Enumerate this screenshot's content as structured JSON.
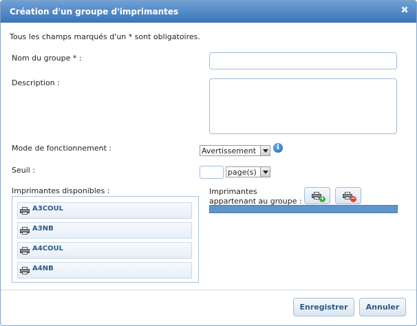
{
  "dialog": {
    "title": "Création d'un groupe d'imprimantes",
    "close_icon": "close-icon"
  },
  "form": {
    "required_note": "Tous les champs marqués d'un * sont obligatoires.",
    "group_name_label": "Nom du groupe * :",
    "group_name_value": "",
    "description_label": "Description :",
    "description_value": "",
    "mode_label": "Mode de fonctionnement :",
    "mode_value": "Avertissement",
    "threshold_label": "Seuil :",
    "threshold_value": "",
    "threshold_unit": "page(s)",
    "available_label": "Imprimantes disponibles :",
    "member_label_line1": "Imprimantes",
    "member_label_line2": "appartenant au groupe :"
  },
  "available_printers": [
    {
      "name": "A3COUL"
    },
    {
      "name": "A3NB"
    },
    {
      "name": "A4COUL"
    },
    {
      "name": "A4NB"
    }
  ],
  "buttons": {
    "save": "Enregistrer",
    "cancel": "Annuler"
  },
  "colors": {
    "title_bar": "#3a75b8",
    "accent": "#2c5a8a",
    "member_bar": "#5d95cc"
  }
}
